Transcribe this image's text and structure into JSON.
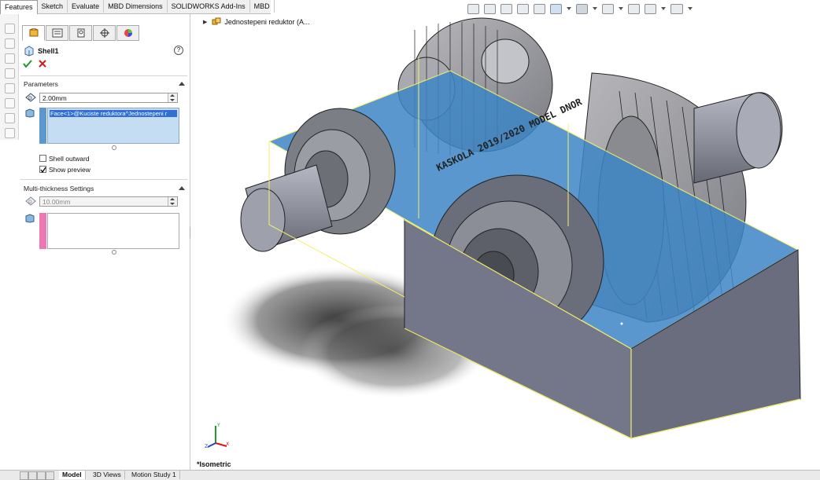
{
  "command_tabs": [
    "Features",
    "Sketch",
    "Evaluate",
    "MBD Dimensions",
    "SOLIDWORKS Add-Ins",
    "MBD"
  ],
  "property_manager": {
    "title": "Shell1",
    "help_label": "?",
    "parameters": {
      "title": "Parameters",
      "thickness": "2.00mm",
      "faces_to_remove": [
        "Face<1>@Kuciste reduktora^Jednostepeni r"
      ],
      "shell_outward_label": "Shell outward",
      "shell_outward_checked": false,
      "show_preview_label": "Show preview",
      "show_preview_checked": true
    },
    "multi_thickness": {
      "title": "Multi-thickness Settings",
      "thickness": "10.00mm",
      "faces": []
    }
  },
  "viewport": {
    "tree_label": "Jednostepeni reduktor  (A...",
    "view_name": "*Isometric",
    "triad_axes": [
      "Y",
      "X",
      "Z"
    ],
    "engraved_text": "KASKOLA 2019/2020 MODEL DNOR"
  },
  "bottom_tabs": [
    "Model",
    "3D Views",
    "Motion Study 1"
  ],
  "colors": {
    "selection_blue": "#3d86c6",
    "edge_yellow": "#f4f06b",
    "housing_grey": "#6a6e7a",
    "accept_green": "#1f9a2b",
    "cancel_red": "#d11a1a",
    "multi_thickness_pink": "#ec77b4"
  },
  "icons": {
    "property_tabs": [
      "feature-manager-icon",
      "property-manager-icon",
      "configuration-manager-icon",
      "dimxpert-icon",
      "appearance-icon"
    ],
    "hud": [
      "zoom-fit-icon",
      "zoom-area-icon",
      "previous-view-icon",
      "section-view-icon",
      "dynamic-annotation-icon",
      "view-orientation-icon",
      "display-style-icon",
      "hide-show-icon",
      "edit-appearance-icon",
      "apply-scene-icon",
      "view-settings-icon"
    ]
  }
}
